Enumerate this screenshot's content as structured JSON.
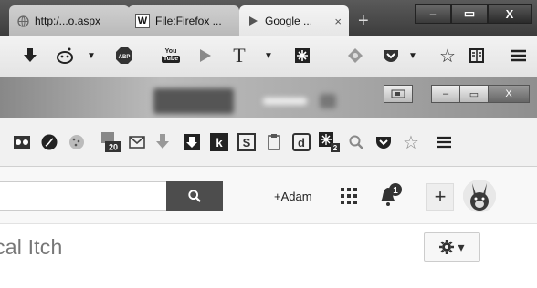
{
  "tabs": [
    {
      "label": "http:/...o.aspx",
      "favicon": "globe-icon"
    },
    {
      "label": "File:Firefox ...",
      "favicon": "wikipedia-icon",
      "favicon_text": "W"
    },
    {
      "label": "Google ...",
      "favicon": "play-icon",
      "close": "×"
    }
  ],
  "new_tab": "+",
  "window_buttons": {
    "minimize": "–",
    "maximize": "▭",
    "close": "X"
  },
  "nav_icons": [
    "download-arrow-icon",
    "reddit-icon",
    "chevron-down-icon",
    "adblock-icon",
    "youtube-icon",
    "play-arrow-icon",
    "text-T-icon",
    "chevron-down-icon",
    "puzzle-icon",
    "tag-icon",
    "pocket-icon",
    "star-outline-icon",
    "reader-icon",
    "menu-icon"
  ],
  "nav_text": {
    "abp": "ABP",
    "you": "You",
    "tube": "Tube",
    "T": "T"
  },
  "inner_window_buttons": {
    "minimize": "–",
    "maximize": "▭",
    "close": "X"
  },
  "bookmarks": [
    "glasses-icon",
    "pinterest-icon",
    "cookie-icon",
    "badge-20-icon",
    "mail-icon",
    "download-icon",
    "down-arrow-icon",
    "k-icon",
    "S-icon",
    "clipboard-icon",
    "d-icon",
    "puzzle-2-icon",
    "search-icon",
    "pocket-icon",
    "star-outline-icon",
    "menu-icon"
  ],
  "bookmark_text": {
    "badge": "20",
    "k": "k",
    "S": "S",
    "d": "d",
    "badge2": "2"
  },
  "search": {
    "value": "",
    "placeholder": ""
  },
  "google_bar": {
    "user": "+Adam",
    "notification_count": "1",
    "plus": "+"
  },
  "page": {
    "title": "cal Itch",
    "gear_caret": "▾"
  },
  "colors": {
    "chrome_dark": "#3c3c3c",
    "search_button": "#4d4d4d",
    "title_text": "#777777"
  }
}
